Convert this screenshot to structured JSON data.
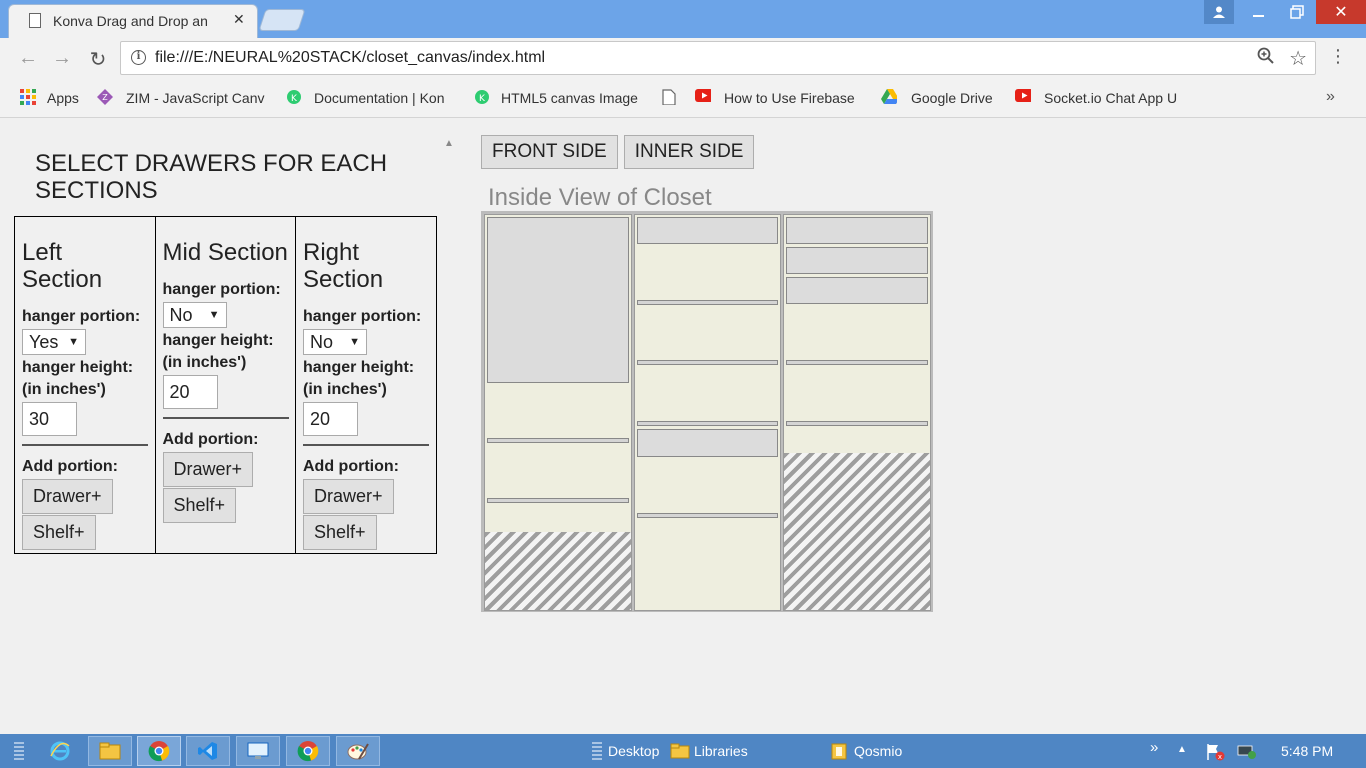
{
  "browser": {
    "tab_title": "Konva Drag and Drop an",
    "url": "file:///E:/NEURAL%20STACK/closet_canvas/index.html",
    "bookmarks": [
      {
        "label": "Apps",
        "icon": "apps-grid-icon"
      },
      {
        "label": "ZIM - JavaScript Canv",
        "icon": "zim-icon"
      },
      {
        "label": "Documentation | Kon",
        "icon": "konva-icon"
      },
      {
        "label": "HTML5 canvas Image",
        "icon": "konva-icon"
      },
      {
        "label": "",
        "icon": "page-icon"
      },
      {
        "label": "How to Use Firebase",
        "icon": "youtube-icon"
      },
      {
        "label": "Google Drive",
        "icon": "google-drive-icon"
      },
      {
        "label": "Socket.io Chat App U",
        "icon": "youtube-icon"
      }
    ],
    "bookmarks_more": "»"
  },
  "panel": {
    "heading": "SELECT DRAWERS FOR EACH SECTIONS",
    "sections": [
      {
        "title": "Left Section",
        "hanger_label": "hanger portion:",
        "hanger_value": "Yes",
        "height_label": "hanger height:",
        "height_unit": "(in inches')",
        "height_value": "30",
        "add_label": "Add portion:",
        "drawer_btn": "Drawer+",
        "shelf_btn": "Shelf+"
      },
      {
        "title": "Mid Section",
        "hanger_label": "hanger portion:",
        "hanger_value": "No",
        "height_label": "hanger height:",
        "height_unit": "(in inches')",
        "height_value": "20",
        "add_label": "Add portion:",
        "drawer_btn": "Drawer+",
        "shelf_btn": "Shelf+"
      },
      {
        "title": "Right Section",
        "hanger_label": "hanger portion:",
        "hanger_value": "No",
        "height_label": "hanger height:",
        "height_unit": "(in inches')",
        "height_value": "20",
        "add_label": "Add portion:",
        "drawer_btn": "Drawer+",
        "shelf_btn": "Shelf+"
      }
    ]
  },
  "view": {
    "front_btn": "FRONT SIDE",
    "inner_btn": "INNER SIDE",
    "title": "Inside View of Closet"
  },
  "colors": {
    "closet_background": "#eeeedf",
    "drawer_fill": "#dcdcdc",
    "hatch": "#9e9e9e",
    "taskbar": "#4f86c4"
  },
  "taskbar": {
    "desktop": "Desktop",
    "libraries": "Libraries",
    "user": "Qosmio",
    "expand": "»",
    "time": "5:48 PM"
  }
}
